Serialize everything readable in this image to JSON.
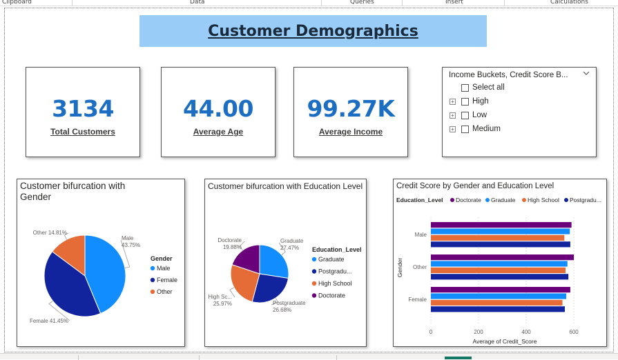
{
  "ribbon": {
    "sections": [
      "Clipboard",
      "Data",
      "Queries",
      "Insert",
      "Calculations"
    ]
  },
  "title": "Customer Demographics",
  "cards": [
    {
      "value": "3134",
      "label": "Total Customers"
    },
    {
      "value": "44.00",
      "label": "Average Age"
    },
    {
      "value": "99.27K",
      "label": "Average Income"
    }
  ],
  "slicer": {
    "title": "Income Buckets, Credit Score B...",
    "select_all": "Select all",
    "items": [
      "High",
      "Low",
      "Medium"
    ],
    "expander_glyph": "+"
  },
  "chart_data": [
    {
      "type": "pie",
      "title": "Customer bifurcation with Gender",
      "legend_title": "Gender",
      "legend_position": "right",
      "categories": [
        "Male",
        "Female",
        "Other"
      ],
      "values": [
        43.75,
        41.45,
        14.81
      ],
      "data_labels": [
        "43.75%",
        "41.45%",
        "14.81%"
      ],
      "colors": [
        "#118dff",
        "#12239e",
        "#e66c37"
      ]
    },
    {
      "type": "pie",
      "title": "Customer bifurcation with Education Level",
      "legend_title": "Education_Level",
      "legend_position": "right",
      "categories": [
        "Graduate",
        "Postgraduate",
        "High School",
        "Doctorate"
      ],
      "legend_labels": [
        "Graduate",
        "Postgradu...",
        "High School",
        "Doctorate"
      ],
      "slice_labels": [
        "Graduate",
        "Postgraduate",
        "High Sc...",
        "Doctorate"
      ],
      "values": [
        27.47,
        26.68,
        25.97,
        19.88
      ],
      "data_labels": [
        "27.47%",
        "26.68%",
        "25.97%",
        "19.88%"
      ],
      "colors": [
        "#118dff",
        "#12239e",
        "#e66c37",
        "#6b007b"
      ]
    },
    {
      "type": "bar",
      "orientation": "horizontal",
      "title": "Credit Score by Gender and Education Level",
      "legend_title": "Education_Level",
      "legend_position": "top-left",
      "categories": [
        "Male",
        "Other",
        "Female"
      ],
      "series": [
        {
          "name": "Doctorate",
          "legend_label": "Doctorate",
          "color": "#6b007b",
          "values": [
            590,
            600,
            585
          ]
        },
        {
          "name": "Graduate",
          "legend_label": "Graduate",
          "color": "#118dff",
          "values": [
            583,
            573,
            568
          ]
        },
        {
          "name": "High School",
          "legend_label": "High School",
          "color": "#e66c37",
          "values": [
            560,
            565,
            552
          ]
        },
        {
          "name": "Postgraduate",
          "legend_label": "Postgradu...",
          "color": "#12239e",
          "values": [
            585,
            577,
            562
          ]
        }
      ],
      "xlabel": "Average of Credit_Score",
      "ylabel": "Gender",
      "xlim": [
        0,
        620
      ],
      "xticks": [
        "0",
        "200",
        "400",
        "600"
      ],
      "xtick_values": [
        0,
        200,
        400,
        600
      ],
      "grid": true
    }
  ]
}
